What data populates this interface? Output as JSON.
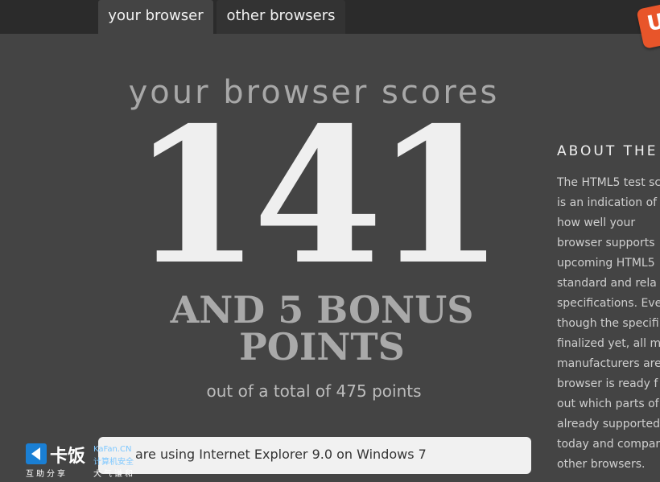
{
  "nav": {
    "tabs": [
      {
        "label": "your browser",
        "active": true
      },
      {
        "label": "other browsers",
        "active": false
      }
    ]
  },
  "badge": {
    "label": "U",
    "color": "#e8552a"
  },
  "score": {
    "heading": "your browser scores",
    "points": "141",
    "bonus_line1": "AND 5 BONUS",
    "bonus_line2": "POINTS",
    "total": "out of a total of 475 points"
  },
  "using": {
    "text": "are using Internet Explorer 9.0 on Windows 7"
  },
  "about": {
    "heading": "ABOUT THE",
    "lines": [
      "The HTML5 test sc",
      "is an indication of",
      "how well your",
      "browser supports",
      "upcoming HTML5",
      "standard and rela",
      "specifications. Eve",
      "though the specifi",
      "finalized yet, all m",
      "manufacturers are",
      "browser is ready f",
      "out which parts of",
      "already supported",
      "today and compar",
      "other browsers."
    ]
  },
  "watermark": {
    "name": "卡饭",
    "site": "KaFan.CN",
    "site_sub": "计算机安全",
    "tag1": "互助分享",
    "tag2": "大气谦和"
  }
}
